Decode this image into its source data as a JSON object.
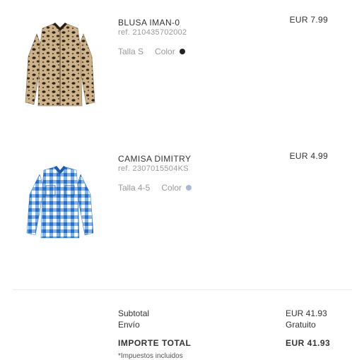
{
  "cart": {
    "items": [
      {
        "name": "BLUSA IMAN-0",
        "ref": "ref. 210435702002",
        "size": "Talla S",
        "color_label": "Color",
        "color_swatch": "#222222",
        "price": "EUR 7.99",
        "image_icon": "leopard-print-blouse"
      },
      {
        "name": "CAMISA DIMITRY",
        "ref": "ref. 2307015504KS",
        "size": "Talla 4-5",
        "color_label": "Color",
        "color_swatch": "#a9b9d6",
        "price": "EUR 4.99",
        "image_icon": "blue-gingham-shirt"
      }
    ]
  },
  "summary": {
    "subtotal_label": "Subtotal",
    "subtotal_value": "EUR 41.93",
    "shipping_label": "Envío",
    "shipping_value": "Gratuito",
    "total_label": "IMPORTE TOTAL",
    "total_value": "EUR 41.93",
    "tax_note": "*Impuestos incluidos"
  },
  "colors": {
    "text": "#333333",
    "muted": "#999999",
    "divider": "#ececec",
    "leopard_base": "#c9b38f",
    "gingham_blue": "#3b82d6"
  }
}
